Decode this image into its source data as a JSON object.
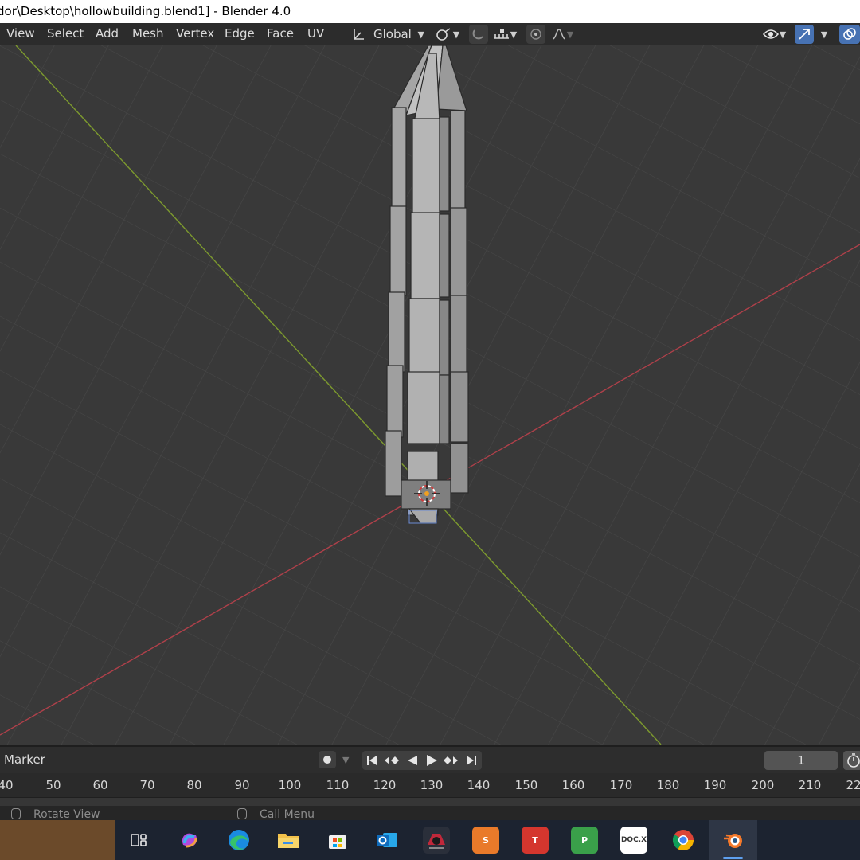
{
  "window": {
    "title": "dor\\Desktop\\hollowbuilding.blend1] - Blender 4.0"
  },
  "header": {
    "menus": [
      "View",
      "Select",
      "Add",
      "Mesh",
      "Vertex",
      "Edge",
      "Face",
      "UV"
    ],
    "transform_orientation": "Global"
  },
  "timeline": {
    "marker_label": "Marker",
    "current_frame": "1",
    "ticks": [
      "40",
      "50",
      "60",
      "70",
      "80",
      "90",
      "100",
      "110",
      "120",
      "130",
      "140",
      "150",
      "160",
      "170",
      "180",
      "190",
      "200",
      "210",
      "22"
    ]
  },
  "statusbar": {
    "left_hint": "Rotate View",
    "right_hint": "Call Menu"
  },
  "taskbar": {
    "items": [
      {
        "icon": "task-view-icon"
      },
      {
        "icon": "copilot-icon"
      },
      {
        "icon": "edge-icon"
      },
      {
        "icon": "file-explorer-icon"
      },
      {
        "icon": "microsoft-store-icon"
      },
      {
        "icon": "outlook-icon"
      },
      {
        "icon": "game-icon"
      },
      {
        "icon": "wps-spreadsheet-icon",
        "text": "S"
      },
      {
        "icon": "wps-writer-icon",
        "text": "T"
      },
      {
        "icon": "wps-presentation-icon",
        "text": "P"
      },
      {
        "icon": "docx-icon",
        "text": "DOC.X"
      },
      {
        "icon": "chrome-icon"
      },
      {
        "icon": "blender-icon"
      }
    ]
  },
  "colors": {
    "viewport_bg": "#3a3a3a",
    "grid": "#4a4a4a",
    "x_axis": "#b0404a",
    "y_axis": "#7d9a2e",
    "mesh_face": "#9b9b9b",
    "accent_blue": "#4772b3"
  }
}
